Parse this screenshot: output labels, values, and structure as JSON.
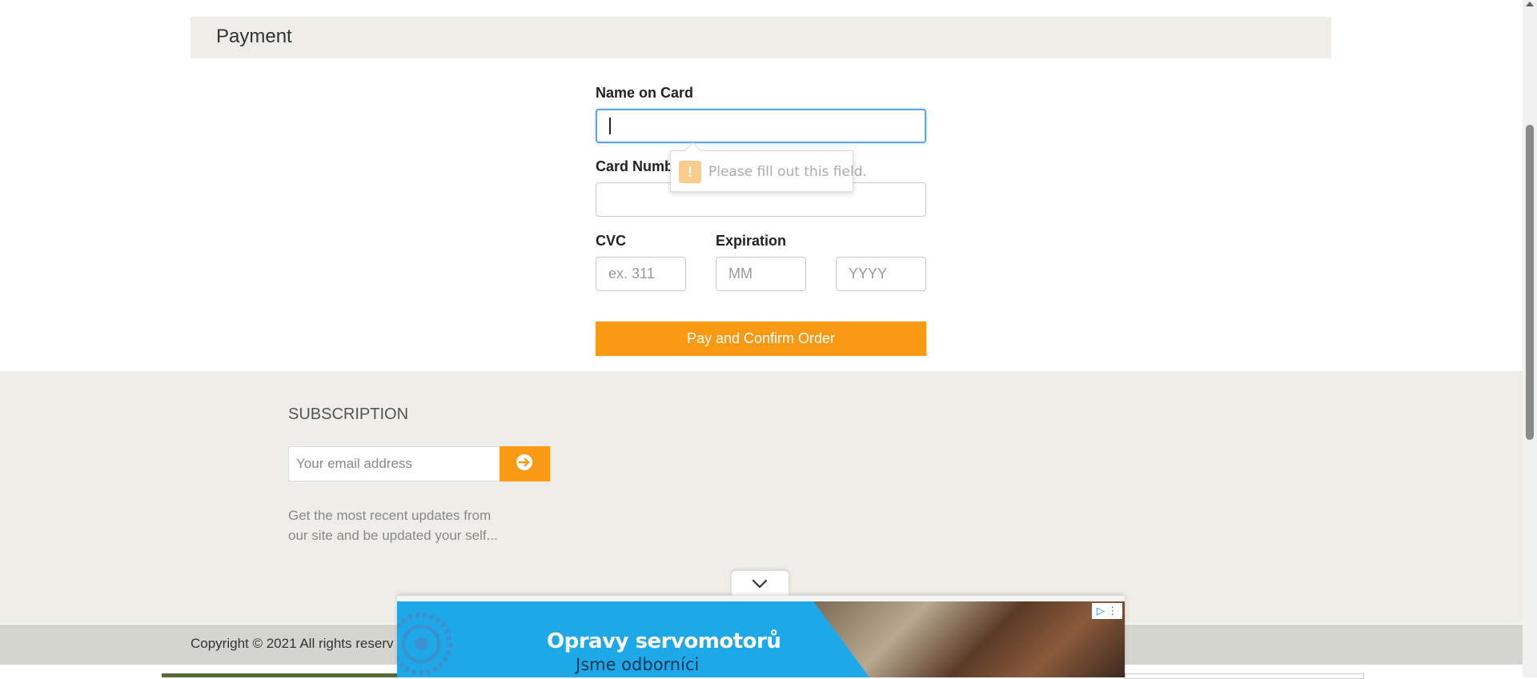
{
  "payment": {
    "title": "Payment",
    "name_label": "Name on Card",
    "name_value": "",
    "card_label": "Card Number",
    "card_value": "",
    "cvc_label": "CVC",
    "cvc_placeholder": "ex. 311",
    "expiration_label": "Expiration",
    "month_placeholder": "MM",
    "year_placeholder": "YYYY",
    "validation_message": "Please fill out this field.",
    "submit_label": "Pay and Confirm Order"
  },
  "subscription": {
    "title": "SUBSCRIPTION",
    "email_placeholder": "Your email address",
    "description_line1": "Get the most recent updates from",
    "description_line2": "our site and be updated your self..."
  },
  "footer": {
    "copyright": "Copyright © 2021 All rights reserv"
  },
  "ad": {
    "headline": "Opravy servomotorů",
    "subline": "Jsme odborníci"
  },
  "colors": {
    "accent": "#fa9a14",
    "focus": "#5aa6f0",
    "ad_blue": "#1ea8e8",
    "section_bg": "#eeede8"
  }
}
